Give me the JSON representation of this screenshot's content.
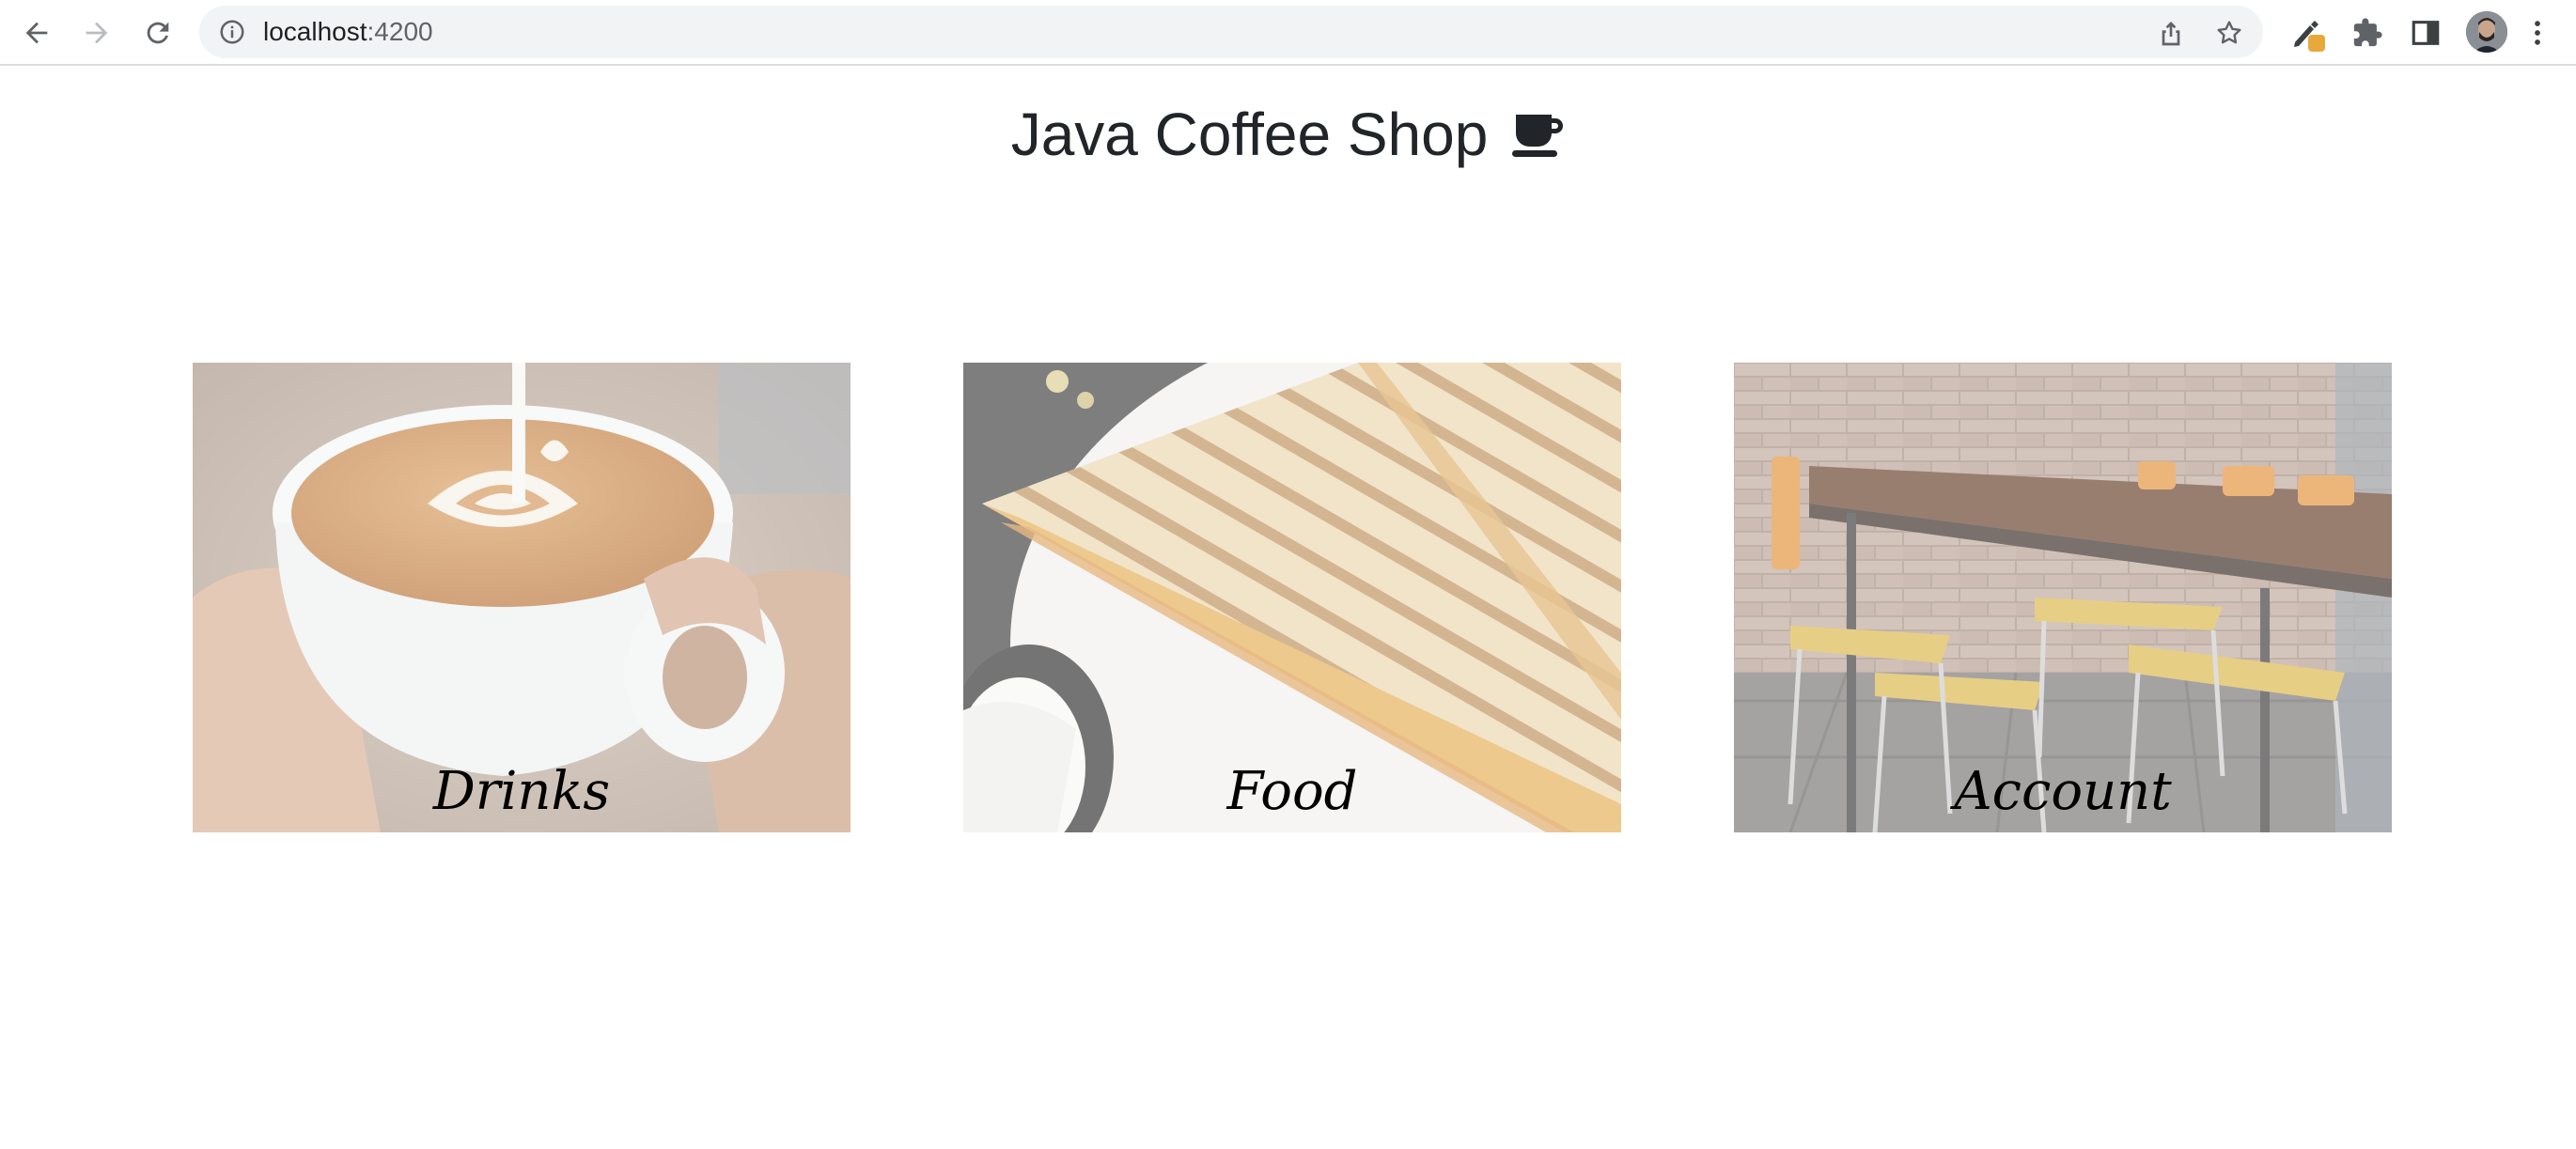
{
  "browser": {
    "url_host": "localhost",
    "url_port": ":4200"
  },
  "page": {
    "title": "Java Coffee Shop"
  },
  "cards": [
    {
      "label": "Drinks"
    },
    {
      "label": "Food"
    },
    {
      "label": "Account"
    }
  ],
  "colors": {
    "title": "#212529",
    "chrome_bg": "#ffffff",
    "omnibox_bg": "#f1f3f4",
    "icon": "#5f6368"
  },
  "icons": [
    "back-icon",
    "forward-icon",
    "reload-icon",
    "info-icon",
    "share-icon",
    "star-icon",
    "pen-extension-icon",
    "puzzle-icon",
    "side-panel-icon",
    "kebab-menu-icon",
    "coffee-cup-icon"
  ]
}
